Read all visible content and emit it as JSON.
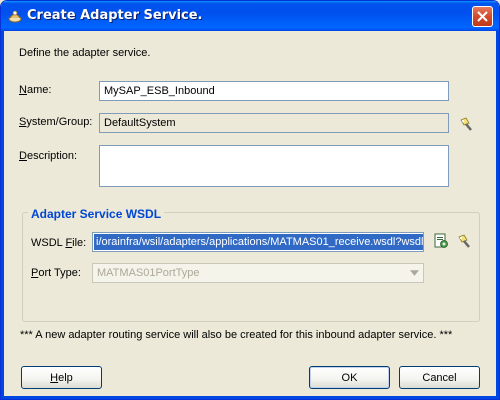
{
  "window": {
    "title": "Create Adapter Service."
  },
  "intro_text": "Define the adapter service.",
  "fields": {
    "name": {
      "label_prefix": "",
      "label_mnemonic": "N",
      "label_rest": "ame:",
      "value": "MySAP_ESB_Inbound"
    },
    "system_group": {
      "label_prefix": "",
      "label_mnemonic": "S",
      "label_rest": "ystem/Group:",
      "value": "DefaultSystem"
    },
    "description": {
      "label_prefix": "",
      "label_mnemonic": "D",
      "label_rest": "escription:",
      "value": ""
    }
  },
  "wsdl_group": {
    "title": "Adapter Service WSDL",
    "wsdl_file": {
      "label_prefix": "WSDL ",
      "label_mnemonic": "F",
      "label_rest": "ile:",
      "value": "i/orainfra/wsil/adapters/applications/MATMAS01_receive.wsdl?wsdl"
    },
    "port_type": {
      "label_prefix": "",
      "label_mnemonic": "P",
      "label_rest": "ort Type:",
      "value": "MATMAS01PortType"
    }
  },
  "note": "*** A new adapter routing service will also be created for this inbound adapter service. ***",
  "buttons": {
    "help": {
      "mnemonic": "H",
      "rest": "elp"
    },
    "ok": "OK",
    "cancel": "Cancel"
  },
  "icons": {
    "title": "oracle-adapter-icon",
    "close": "close-icon",
    "browse_system": "flashlight-icon",
    "browse_wsdl": "flashlight-icon",
    "wsdl_service": "wsdl-document-icon"
  }
}
